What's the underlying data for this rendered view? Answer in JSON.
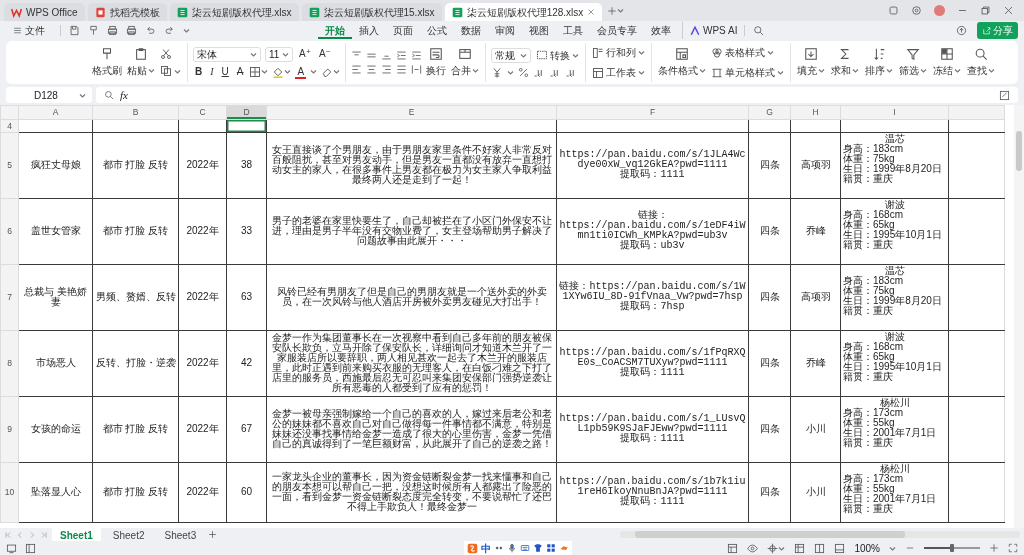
{
  "window": {
    "tabs": [
      {
        "label": "WPS Office",
        "kind": "home",
        "selected": false
      },
      {
        "label": "找稻壳模板",
        "kind": "template",
        "selected": false
      },
      {
        "label": "柒云短剧版权代理.xlsx",
        "kind": "sheet",
        "selected": false
      },
      {
        "label": "柒云短剧版权代理15.xlsx",
        "kind": "sheet",
        "selected": false
      },
      {
        "label": "柒云短剧版权代理128.xlsx",
        "kind": "sheet",
        "selected": true
      }
    ]
  },
  "menu": {
    "file": "文件",
    "tabs": [
      {
        "label": "开始",
        "selected": true
      },
      {
        "label": "插入",
        "selected": false
      },
      {
        "label": "页面",
        "selected": false
      },
      {
        "label": "公式",
        "selected": false
      },
      {
        "label": "数据",
        "selected": false
      },
      {
        "label": "审阅",
        "selected": false
      },
      {
        "label": "视图",
        "selected": false
      },
      {
        "label": "工具",
        "selected": false
      },
      {
        "label": "会员专享",
        "selected": false
      },
      {
        "label": "效率",
        "selected": false
      }
    ],
    "ai": "WPS AI",
    "share": "分享"
  },
  "ribbon": {
    "clipboard": [
      {
        "label": "格式刷",
        "dropdown": false
      },
      {
        "label": "粘贴",
        "dropdown": true
      }
    ],
    "font": {
      "name": "宋体",
      "size": "11",
      "grow": "A⁺",
      "shrink": "A⁻"
    },
    "styles": [
      {
        "label": "B",
        "kind": "bold"
      },
      {
        "label": "I",
        "kind": "italic"
      },
      {
        "label": "U",
        "kind": "underline"
      },
      {
        "label": "A",
        "kind": "strike"
      }
    ],
    "font_color": "A",
    "wrap": [
      {
        "label": "换行",
        "dropdown": false
      },
      {
        "label": "合并",
        "dropdown": true
      }
    ],
    "number_format": "常规",
    "convert": "转换",
    "sheet_tools": [
      {
        "label": "行和列"
      },
      {
        "label": "工作表"
      }
    ],
    "cond_format": "条件格式",
    "style_tools": [
      {
        "label": "表格样式"
      },
      {
        "label": "单元格样式"
      }
    ],
    "tools": [
      {
        "label": "填充"
      },
      {
        "label": "求和"
      },
      {
        "label": "排序"
      },
      {
        "label": "筛选"
      },
      {
        "label": "冻结"
      },
      {
        "label": "查找"
      }
    ]
  },
  "formula_bar": {
    "cell": "D128",
    "fx": "fx"
  },
  "columns": [
    {
      "label": "A",
      "selected": false
    },
    {
      "label": "B",
      "selected": false
    },
    {
      "label": "C",
      "selected": false
    },
    {
      "label": "D",
      "selected": true
    },
    {
      "label": "E",
      "selected": false
    },
    {
      "label": "F",
      "selected": false
    },
    {
      "label": "G",
      "selected": false
    },
    {
      "label": "H",
      "selected": false
    },
    {
      "label": "I",
      "selected": false
    }
  ],
  "blank_row": "4",
  "rows": [
    {
      "number": "5",
      "col_a": "疯狂丈母娘",
      "col_b": "都市 打脸 反转",
      "col_c": "2022年",
      "col_d": "38",
      "col_e": [
        "女王直接谈了个男朋友，由于男朋友家里条件不好家人非常反对百般阻扰，甚至对男友动手，但是男友一直都没有放弃一直想打动女主的家人，在很多事件上男友都在极力为女主家人争取利益最终两人还是走到了一起！"
      ],
      "col_f": "https://pan.baidu.com/s/1JLA4Wcdye00xW_vq12GkEA?pwd=1111\n提取码：1111",
      "col_g": "四条",
      "col_h": "高项羽",
      "col_i": {
        "name": "温芯",
        "profile": [
          "身高：183cm",
          "体重：75kg",
          "生日：1999年8月20日",
          "籍贯：重庆"
        ]
      }
    },
    {
      "number": "6",
      "col_a": "盖世女管家",
      "col_b": "都市 打脸 反转",
      "col_c": "2022年",
      "col_d": "33",
      "col_e": [
        "男子的老婆在家里快要生了，自己却被拦在了小区门外保安不让进，理由是男子半年没有交物业费了，女主登场帮助男子解决了问题故事由此展开・・・"
      ],
      "col_f": "链接：\nhttps://pan.baidu.com/s/1eDF4iWmn1ti0ICWh_KMPkA?pwd=ub3v\n提取码：ub3v",
      "col_g": "四条",
      "col_h": "乔峰",
      "col_i": {
        "name": "谢波",
        "profile": [
          "身高：168cm",
          "体重：65kg",
          "生日：1995年10月1日",
          "籍贯：重庆"
        ]
      }
    },
    {
      "number": "7",
      "col_a": "总裁与 美艳娇妻",
      "col_b": "男频、赘婿、反转",
      "col_c": "2022年",
      "col_d": "63",
      "col_e": [
        "风铃已经有男朋友了但是自己的男朋友就是一个送外卖的外卖员，在一次风铃与他人酒店开房被外卖男友碰见大打出手！"
      ],
      "col_f": "链接：https://pan.baidu.com/s/1W1XYw6IU_8D-91fVnaa_Vw?pwd=7hsp\n提取码：7hsp",
      "col_g": "四条",
      "col_h": "高项羽",
      "col_i": {
        "name": "温芯",
        "profile": [
          "身高：183cm",
          "体重：75kg",
          "生日：1999年8月20日",
          "籍贯：重庆"
        ]
      }
    },
    {
      "number": "8",
      "col_a": "市场恶人",
      "col_b": "反转、打脸・逆袭",
      "col_c": "2022年",
      "col_d": "42",
      "col_e": [
        "金梦一作为集团董事长在一次视察中看到自己多年前的朋友被保安队长欺负，立马开除了保安队长，详细询问才知道木兰开了一家服装店所以要辞职，两人相见甚欢一起去了木兰开的服装店里，此时正遇到前来购买衣服的无理客人，在白饭刁难之下打了店里的服务员，西施最后忍无可忍叫来集团安保部门强势逆袭让所有恶毒的人都受到了应有的惩罚！"
      ],
      "col_f": "https://pan.baidu.com/s/1fPqRXQE0s_CoACSM7TUXyw?pwd=1111\n提取码：1111",
      "col_g": "四条",
      "col_h": "乔峰",
      "col_i": {
        "name": "谢波",
        "profile": [
          "身高：168cm",
          "体重：65kg",
          "生日：1995年10月1日",
          "籍贯：重庆"
        ]
      }
    },
    {
      "number": "9",
      "col_a": "女孩的命运",
      "col_b": "都市 打脸 反转",
      "col_c": "2022年",
      "col_d": "67",
      "col_e": [
        "金梦一被母亲强制嫁给一个自己的喜欢的人，嫁过来后老公和老公的妹妹都不喜欢自己对自己做得每一件事情都不满意，特别是妹妹还没事找事情给金梦一造成了很大的心里伤害，金梦一凭借自己的真诚得到了一笔巨额财富，从此展开了自己的逆袭之路！"
      ],
      "col_f": "https://pan.baidu.com/s/1_LUsvQL1pb59K9SJaFJEww?pwd=1111\n提取码：1111",
      "col_g": "四条",
      "col_h": "小川",
      "col_i": {
        "name": "杨松川",
        "profile": [
          "身高：173cm",
          "体重：55kg",
          "生日：2001年7月1日",
          "籍贯：重庆"
        ]
      }
    },
    {
      "number": "10",
      "col_a": "坠落显人心",
      "col_b": "都市 打脸 反转",
      "col_c": "2022年",
      "col_d": "60",
      "col_e": [
        "一家龙头企业的董事长，因为资金链断裂金梦一找来懂事和自己",
        "的朋友本想可以帮自己一把，没想这时候所有人都露出了险恶的一面，看到金梦一资金链断裂态度完全转变，不要说帮忙了还巴不得上手欺负人！最终金梦一"
      ],
      "col_f": "https://pan.baidu.com/s/1b7k1iu1reH6IkoyNnuBnJA?pwd=1111\n提取码：1111",
      "col_g": "四条",
      "col_h": "小川",
      "col_i": {
        "name": "杨松川",
        "profile": [
          "身高：173cm",
          "体重：55kg",
          "生日：2001年7月1日",
          "籍贯：重庆"
        ]
      }
    }
  ],
  "sheets": [
    {
      "label": "Sheet1",
      "selected": true
    },
    {
      "label": "Sheet2",
      "selected": false
    },
    {
      "label": "Sheet3",
      "selected": false
    }
  ],
  "status_bar": {
    "ime": "中",
    "zoom": "100%",
    "zoom_slider": {
      "level": 0.5
    }
  }
}
